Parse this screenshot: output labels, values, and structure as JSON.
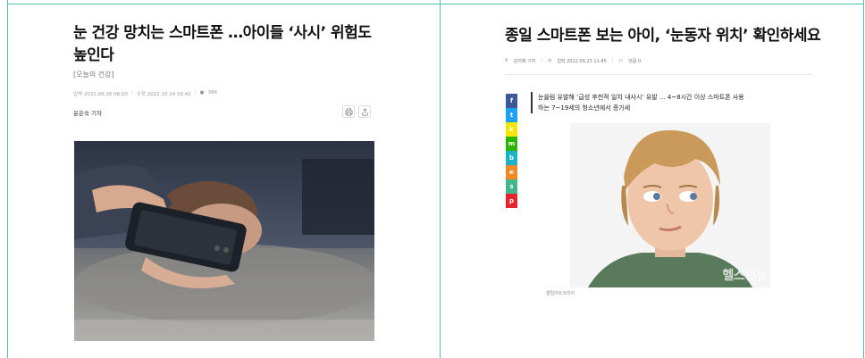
{
  "left_article": {
    "title_line1": "눈 건강 망치는 스마트폰 …아이들 ‘사시’ 위험도",
    "title_line2": "높인다",
    "section": "[오늘의 건강]",
    "published": "입력 2022.09.26 06:00",
    "modified": "수정 2022.10.14 16:42",
    "views": "384",
    "author": "윤은숙 기자"
  },
  "right_article": {
    "title": "종일 스마트폰 보는 아이, ‘눈동자 위치’ 확인하세요",
    "author": "김지예 기자",
    "published": "입력 2022.09.23 11:45",
    "comments": "댓글 0",
    "summary_line1": "눈쏠림 유발해 ‘급성 후천적 일치 내사시’ 유발 ... 4~8시간 이상 스마트폰 사용",
    "summary_line2": "하는 7~19세의 청소년에서 증가세",
    "watermark": "헬스인뉴",
    "caption": "클립아트코리아",
    "share_buttons": [
      {
        "icon": "f",
        "color": "#3b5998"
      },
      {
        "icon": "t",
        "color": "#1da1f2"
      },
      {
        "icon": "k",
        "color": "#f7e600"
      },
      {
        "icon": "m",
        "color": "#2db400"
      },
      {
        "icon": "b",
        "color": "#19b3c9"
      },
      {
        "icon": "e",
        "color": "#f08a24"
      },
      {
        "icon": "s",
        "color": "#43b58d"
      },
      {
        "icon": "p",
        "color": "#e8232b"
      }
    ]
  },
  "colors": {
    "frame": "#4dc3b5"
  }
}
